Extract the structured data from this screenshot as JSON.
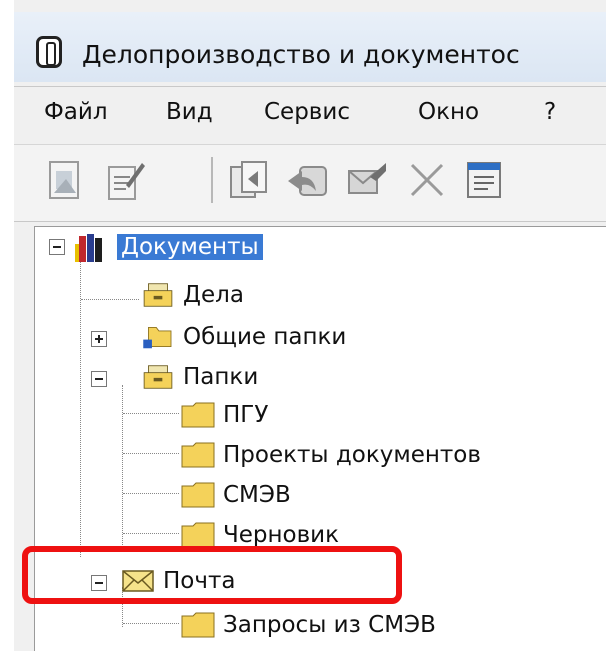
{
  "window": {
    "title": "Делопроизводство и документос"
  },
  "menu": {
    "items": [
      "Файл",
      "Вид",
      "Сервис",
      "Окно",
      "?"
    ]
  },
  "toolbar": {
    "buttons": [
      "new-doc-icon",
      "edit-doc-icon",
      "copy-doc-icon",
      "reply-icon",
      "send-icon",
      "delete-icon",
      "properties-icon"
    ]
  },
  "tree": {
    "root": {
      "label": "Документы",
      "icon": "books-icon"
    },
    "items": [
      {
        "label": "Дела",
        "icon": "folder-cabinet-icon"
      },
      {
        "label": "Общие папки",
        "icon": "shared-folder-icon"
      },
      {
        "label": "Папки",
        "icon": "folder-cabinet-icon"
      },
      {
        "label": "ПГУ",
        "icon": "folder-icon"
      },
      {
        "label": "Проекты документов",
        "icon": "folder-icon"
      },
      {
        "label": "СМЭВ",
        "icon": "folder-icon"
      },
      {
        "label": "Черновик",
        "icon": "folder-icon"
      },
      {
        "label": "Почта",
        "icon": "mail-icon"
      },
      {
        "label": "Запросы из СМЭВ",
        "icon": "folder-icon"
      }
    ]
  },
  "colors": {
    "selection": "#3a7ad4",
    "highlight_box": "#ee1111"
  }
}
